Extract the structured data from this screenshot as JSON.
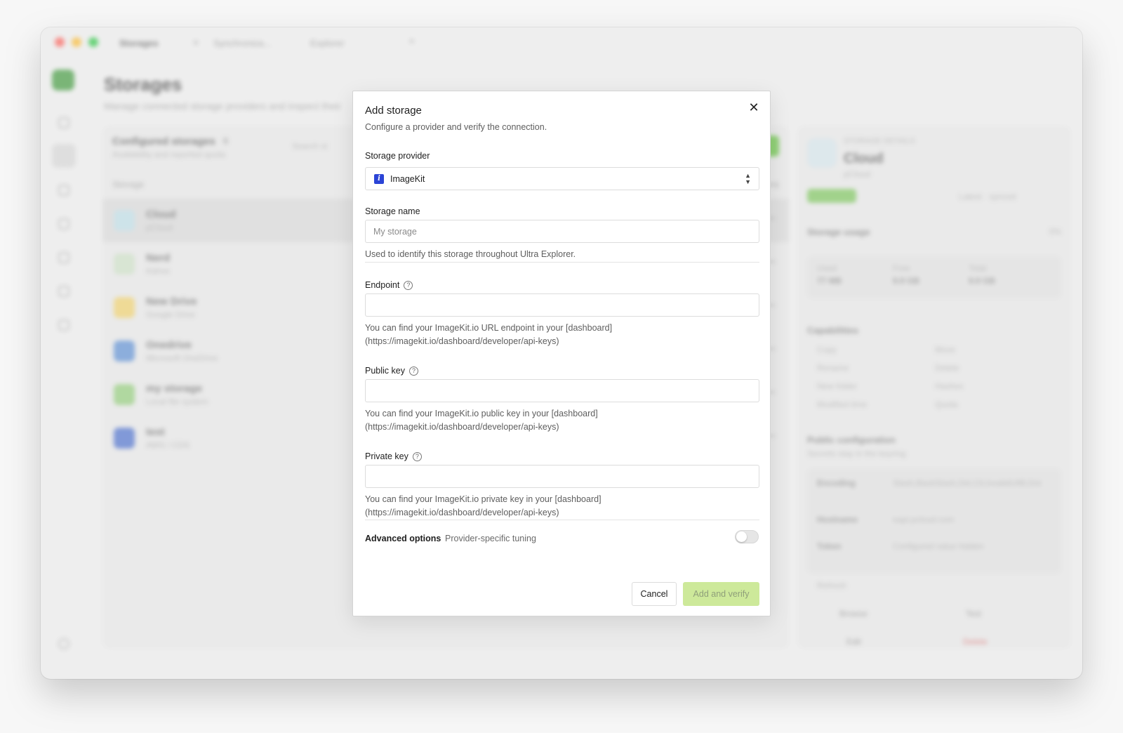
{
  "window": {
    "tabs": [
      "Storages",
      "Synchroniza...",
      "Explorer"
    ],
    "page_title": "Storages",
    "page_subtitle": "Manage connected storage providers and inspect their",
    "list": {
      "title": "Configured storages",
      "count": "6",
      "subtitle": "Availability and reported quota",
      "search_placeholder": "Search st",
      "col_storage": "Storage",
      "col_actions": "Actions",
      "rows": [
        {
          "name": "Cloud",
          "type": "pCloud",
          "color": "#bfe0ea"
        },
        {
          "name": "Nerd",
          "type": "Kdrive",
          "color": "#cfe3c8"
        },
        {
          "name": "New Drive",
          "type": "Google Drive",
          "color": "#f3d36b"
        },
        {
          "name": "Onedrive",
          "type": "Microsoft OneDrive",
          "color": "#5b8fd6"
        },
        {
          "name": "my storage",
          "type": "Local file system",
          "color": "#93cf7a"
        },
        {
          "name": "test",
          "type": "AWS / CDS",
          "color": "#4a6fcf"
        }
      ]
    },
    "detail": {
      "label": "STORAGE DETAILS",
      "name": "Cloud",
      "sub": "pCloud",
      "status": "Available",
      "updated": "Latest · synced",
      "usage_title": "Storage usage",
      "usage_pct": "0%",
      "used_label": "Used",
      "used_val": "77 MB",
      "free_label": "Free",
      "free_val": "9.9 GB",
      "total_label": "Total",
      "total_val": "9.9 GB",
      "capabilities_title": "Capabilities",
      "capabilities": [
        "Copy",
        "Move",
        "Rename",
        "Delete",
        "New folder",
        "Hashes",
        "Modified time",
        "Quota"
      ],
      "public_title": "Public configuration",
      "public_sub": "Secrets stay in the keyring",
      "encoding_label": "Encoding",
      "encoding_val": "Slash,BackSlash,Del,Ctl,InvalidUtf8,Dot",
      "hostname_label": "Hostname",
      "hostname_val": "eapi.pcloud.com",
      "token_label": "Token",
      "token_val": "Configured value hidden",
      "refresh": "Refresh",
      "browse": "Browse",
      "test": "Test",
      "edit": "Edit",
      "delete": "Delete"
    }
  },
  "modal": {
    "title": "Add storage",
    "description": "Configure a provider and verify the connection.",
    "provider_label": "Storage provider",
    "provider_value": "ImageKit",
    "provider_logo_letter": "i",
    "name_label": "Storage name",
    "name_placeholder": "My storage",
    "name_hint": "Used to identify this storage throughout Ultra Explorer.",
    "endpoint_label": "Endpoint",
    "endpoint_value": "",
    "endpoint_hint": "You can find your ImageKit.io URL endpoint in your [dashboard](https://imagekit.io/dashboard/developer/api-keys)",
    "public_key_label": "Public key",
    "public_key_value": "",
    "public_key_hint": "You can find your ImageKit.io public key in your [dashboard](https://imagekit.io/dashboard/developer/api-keys)",
    "private_key_label": "Private key",
    "private_key_value": "",
    "private_key_hint": "You can find your ImageKit.io private key in your [dashboard](https://imagekit.io/dashboard/developer/api-keys)",
    "advanced_label": "Advanced options",
    "advanced_sub": "Provider-specific tuning",
    "advanced_enabled": false,
    "cancel_label": "Cancel",
    "submit_label": "Add and verify",
    "help_glyph": "?",
    "close_glyph": "✕"
  },
  "colors": {
    "accent": "#62c43b",
    "primary_disabled_bg": "#cde99a",
    "overlay": "rgba(230,230,230,0.45)"
  }
}
